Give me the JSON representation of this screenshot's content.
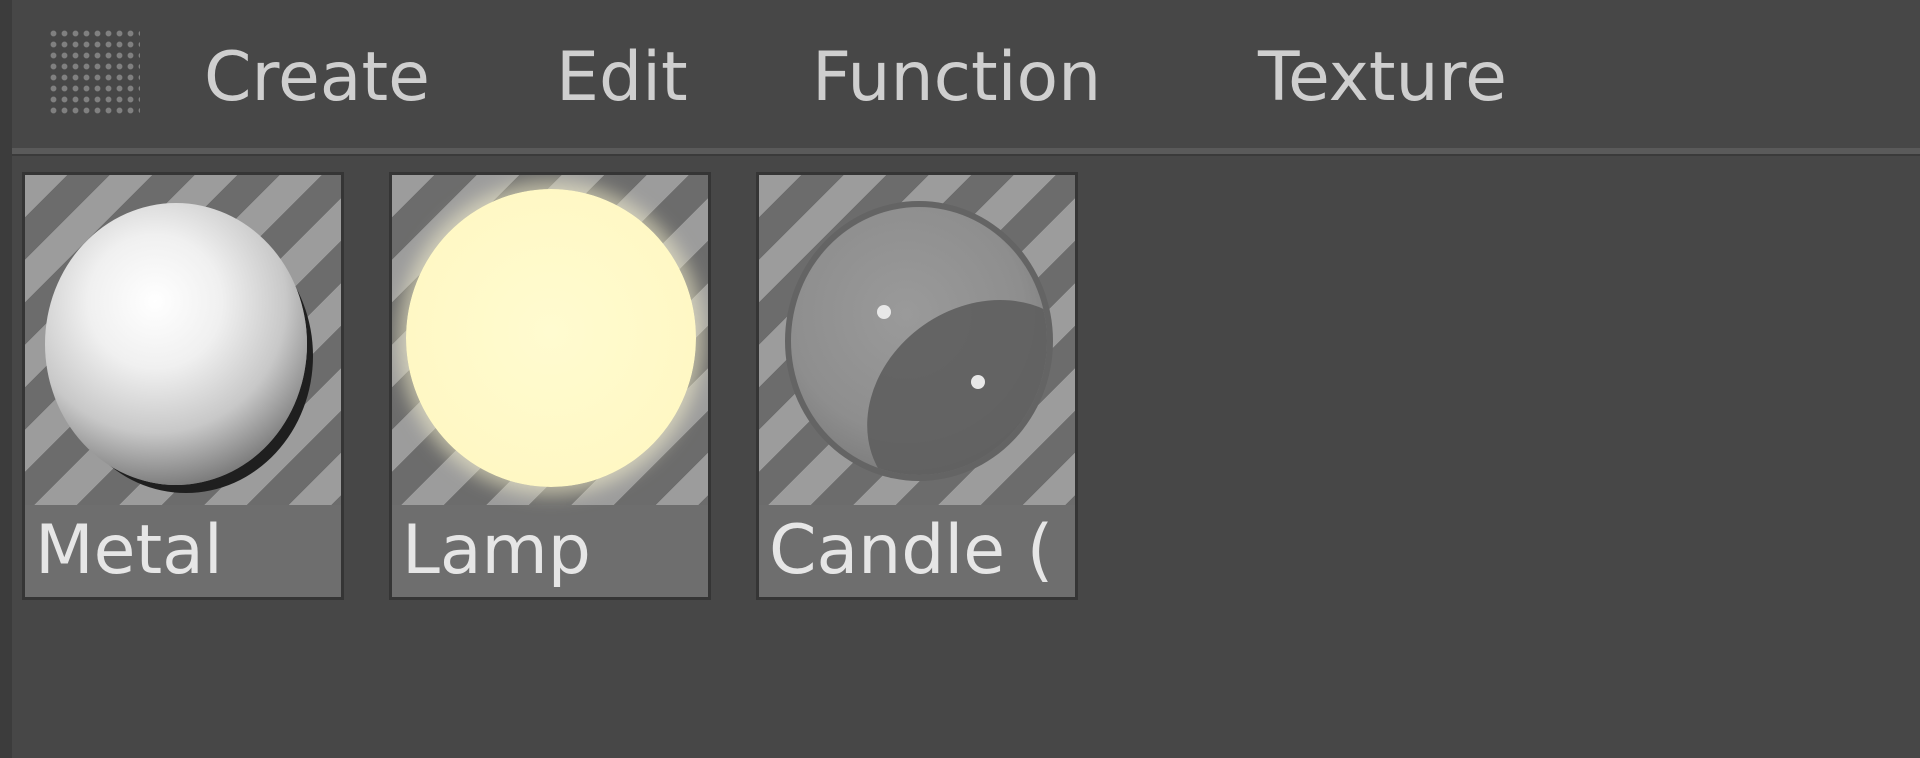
{
  "menubar": {
    "grip_icon": "grip-dots-icon",
    "items": [
      {
        "label": "Create"
      },
      {
        "label": "Edit"
      },
      {
        "label": "Function"
      },
      {
        "label": "Texture"
      }
    ]
  },
  "materials": [
    {
      "label": "Metal",
      "preview_icon": "metal-sphere-icon",
      "accent": "#ffffff"
    },
    {
      "label": "Lamp",
      "preview_icon": "lamp-sphere-icon",
      "accent": "#fff8c4"
    },
    {
      "label": "Candle (",
      "preview_icon": "candle-sphere-icon",
      "accent": "#8e8e8e"
    }
  ],
  "colors": {
    "background": "#474747",
    "menu_text": "#cfcfcf",
    "tile_label_text": "#e6e6e6"
  }
}
